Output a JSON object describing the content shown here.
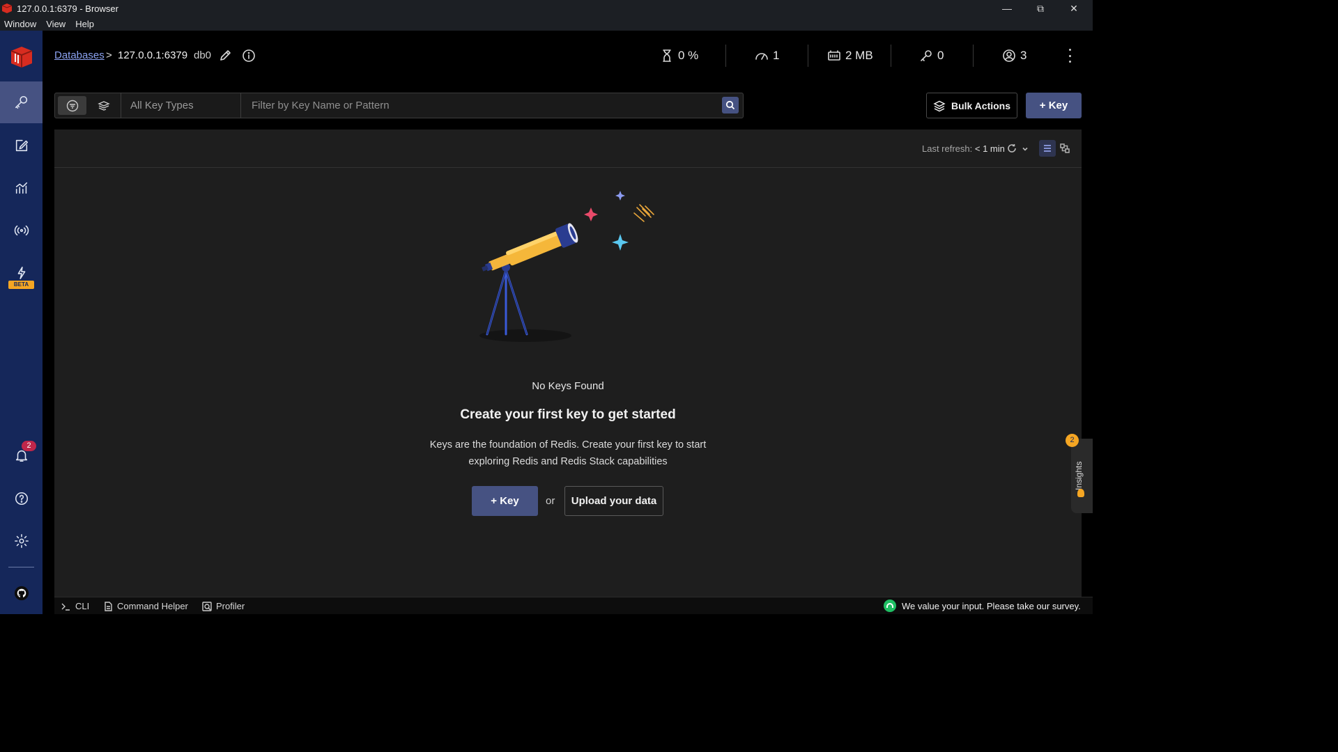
{
  "window": {
    "title": "127.0.0.1:6379 - Browser",
    "menu": [
      "Window",
      "View",
      "Help"
    ]
  },
  "header": {
    "breadcrumb_link": "Databases",
    "breadcrumb_sep": ">",
    "host": "127.0.0.1:6379",
    "db": "db0",
    "stats": {
      "cpu": "0 %",
      "ops": "1",
      "memory": "2 MB",
      "keys": "0",
      "clients": "3"
    }
  },
  "sidebar": {
    "beta_label": "BETA",
    "notifications_count": "2"
  },
  "toolbar": {
    "key_types": "All Key Types",
    "filter_placeholder": "Filter by Key Name or Pattern",
    "bulk_actions": "Bulk Actions",
    "add_key": "+ Key"
  },
  "panel": {
    "last_refresh_label": "Last refresh:",
    "last_refresh_value": "< 1 min"
  },
  "empty_state": {
    "title": "No Keys Found",
    "headline": "Create your first key to get started",
    "description": "Keys are the foundation of Redis. Create your first key to start exploring Redis and Redis Stack capabilities",
    "add_key": "+ Key",
    "or": "or",
    "upload": "Upload your data"
  },
  "insights": {
    "label": "Insights",
    "count": "2"
  },
  "bottombar": {
    "cli": "CLI",
    "command_helper": "Command Helper",
    "profiler": "Profiler",
    "survey": "We value your input. Please take our survey."
  },
  "colors": {
    "accent": "#465282",
    "sidebar": "#15275a",
    "warning": "#f5a623",
    "danger": "#c0264a"
  }
}
